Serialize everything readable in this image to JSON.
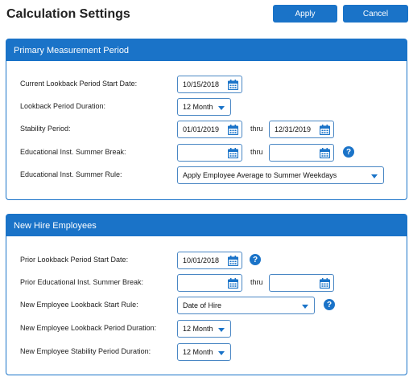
{
  "header": {
    "title": "Calculation Settings",
    "apply_label": "Apply",
    "cancel_label": "Cancel"
  },
  "primary": {
    "title": "Primary Measurement Period",
    "rows": {
      "lookback_start": {
        "label": "Current Lookback Period Start Date:",
        "value": "10/15/2018"
      },
      "lookback_duration": {
        "label": "Lookback Period Duration:",
        "value": "12 Month"
      },
      "stability": {
        "label": "Stability Period:",
        "from": "01/01/2019",
        "thru": "thru",
        "to": "12/31/2019"
      },
      "summer_break": {
        "label": "Educational Inst. Summer Break:",
        "from": "",
        "thru": "thru",
        "to": ""
      },
      "summer_rule": {
        "label": "Educational Inst. Summer Rule:",
        "value": "Apply Employee Average to Summer Weekdays"
      }
    }
  },
  "new_hire": {
    "title": "New Hire Employees",
    "rows": {
      "prior_lookback_start": {
        "label": "Prior Lookback Period Start Date:",
        "value": "10/01/2018"
      },
      "prior_summer_break": {
        "label": "Prior Educational Inst. Summer Break:",
        "from": "",
        "thru": "thru",
        "to": ""
      },
      "start_rule": {
        "label": "New Employee Lookback Start Rule:",
        "value": "Date of Hire"
      },
      "lookback_duration": {
        "label": "New Employee Lookback Period Duration:",
        "value": "12 Month"
      },
      "stability_duration": {
        "label": "New Employee Stability Period Duration:",
        "value": "12 Month"
      }
    }
  },
  "icons": {
    "calendar": "calendar-icon",
    "dropdown": "chevron-down-icon",
    "help": "help-icon",
    "help_glyph": "?"
  },
  "colors": {
    "accent": "#1a73c8",
    "border": "#4a87c4"
  }
}
